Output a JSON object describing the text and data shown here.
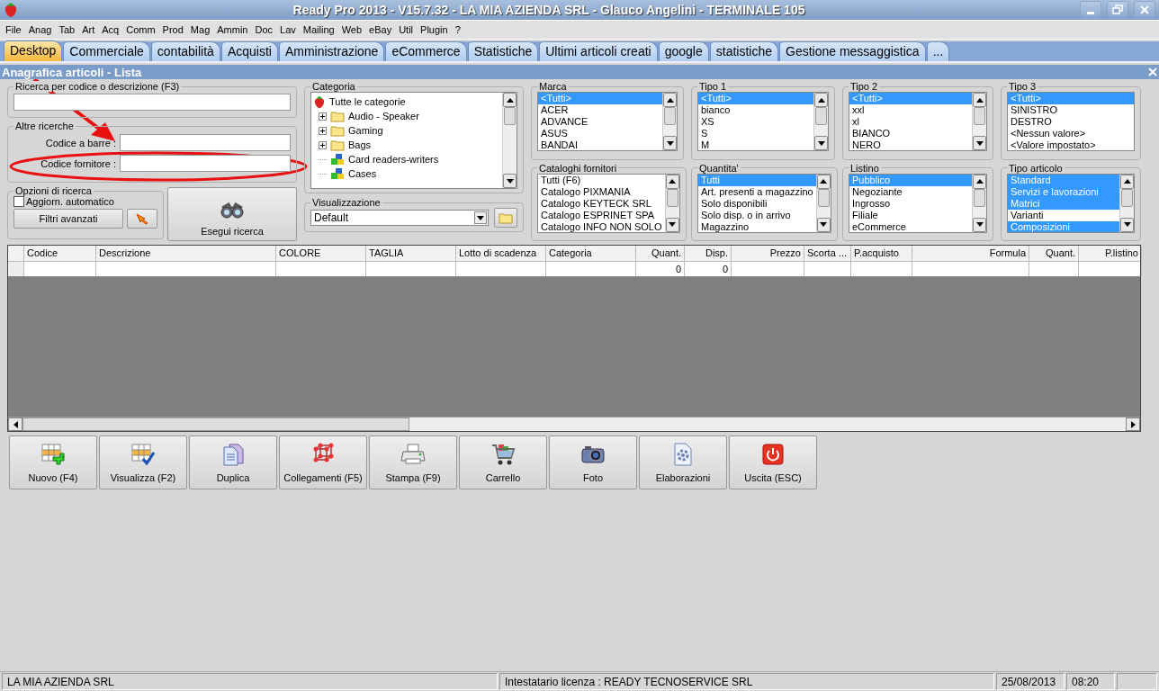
{
  "window": {
    "title": "Ready Pro 2013 - V15.7.32 - LA MIA AZIENDA SRL - Glauco Angelini - TERMINALE 105"
  },
  "menu": [
    "File",
    "Anag",
    "Tab",
    "Art",
    "Acq",
    "Comm",
    "Prod",
    "Mag",
    "Ammin",
    "Doc",
    "Lav",
    "Mailing",
    "Web",
    "eBay",
    "Util",
    "Plugin",
    "?"
  ],
  "tabs": [
    {
      "label": "Desktop",
      "selected": true
    },
    {
      "label": "Commerciale",
      "selected": false
    },
    {
      "label": "contabilità",
      "selected": false
    },
    {
      "label": "Acquisti",
      "selected": false
    },
    {
      "label": "Amministrazione",
      "selected": false
    },
    {
      "label": "eCommerce",
      "selected": false
    },
    {
      "label": "Statistiche",
      "selected": false
    },
    {
      "label": "Ultimi articoli creati",
      "selected": false
    },
    {
      "label": "google",
      "selected": false
    },
    {
      "label": "statistiche",
      "selected": false
    },
    {
      "label": "Gestione messaggistica",
      "selected": false
    },
    {
      "label": "...",
      "selected": false
    }
  ],
  "subwindow": {
    "title": "Anagrafica articoli  - Lista"
  },
  "search": {
    "title": "Ricerca per codice o descrizione (F3)"
  },
  "other_searches": {
    "title": "Altre ricerche",
    "fields": [
      {
        "label": "Codice a barre :"
      },
      {
        "label": "Codice fornitore :"
      }
    ]
  },
  "search_options": {
    "title": "Opzioni di ricerca",
    "checkbox": {
      "label": "Aggiorn. automatico",
      "checked": false
    },
    "filters_button": "Filtri avanzati"
  },
  "run_search_button": "Esegui ricerca",
  "category": {
    "title": "Categoria",
    "tree": [
      {
        "label": "Tutte le categorie",
        "kind": "root",
        "children": [
          {
            "label": "Audio - Speaker",
            "kind": "folder"
          },
          {
            "label": "Gaming",
            "kind": "folder"
          },
          {
            "label": "Bags",
            "kind": "folder"
          },
          {
            "label": "Card readers-writers",
            "kind": "item"
          },
          {
            "label": "Cases",
            "kind": "item"
          }
        ]
      }
    ]
  },
  "view": {
    "title": "Visualizzazione",
    "value": "Default"
  },
  "lists": [
    {
      "title": "Marca",
      "has_scrollbar": true,
      "items": [
        {
          "label": "<Tutti>",
          "selected": true
        },
        {
          "label": "ACER",
          "selected": false
        },
        {
          "label": "ADVANCE",
          "selected": false
        },
        {
          "label": "ASUS",
          "selected": false
        },
        {
          "label": "BANDAI",
          "selected": false
        }
      ]
    },
    {
      "title": "Tipo 1",
      "has_scrollbar": true,
      "items": [
        {
          "label": "<Tutti>",
          "selected": true
        },
        {
          "label": "bianco",
          "selected": false
        },
        {
          "label": "XS",
          "selected": false
        },
        {
          "label": "S",
          "selected": false
        },
        {
          "label": "M",
          "selected": false
        }
      ]
    },
    {
      "title": "Tipo 2",
      "has_scrollbar": true,
      "items": [
        {
          "label": "<Tutti>",
          "selected": true
        },
        {
          "label": "xxl",
          "selected": false
        },
        {
          "label": "xl",
          "selected": false
        },
        {
          "label": "BIANCO",
          "selected": false
        },
        {
          "label": "NERO",
          "selected": false
        }
      ]
    },
    {
      "title": "Tipo 3",
      "has_scrollbar": false,
      "items": [
        {
          "label": "<Tutti>",
          "selected": true
        },
        {
          "label": "SINISTRO",
          "selected": false
        },
        {
          "label": "DESTRO",
          "selected": false
        },
        {
          "label": "<Nessun valore>",
          "selected": false
        },
        {
          "label": "<Valore impostato>",
          "selected": false
        }
      ]
    },
    {
      "title": "Cataloghi fornitori",
      "has_scrollbar": true,
      "items": [
        {
          "label": "Tutti (F6)",
          "selected": false
        },
        {
          "label": "Catalogo PIXMANIA",
          "selected": false
        },
        {
          "label": "Catalogo KEYTECK SRL",
          "selected": false
        },
        {
          "label": "Catalogo ESPRINET SPA",
          "selected": false
        },
        {
          "label": "Catalogo INFO NON SOLO",
          "selected": false
        }
      ]
    },
    {
      "title": "Quantita'",
      "has_scrollbar": true,
      "items": [
        {
          "label": "Tutti",
          "selected": true
        },
        {
          "label": "Art. presenti a magazzino",
          "selected": false
        },
        {
          "label": "Solo disponibili",
          "selected": false
        },
        {
          "label": "Solo disp. o in arrivo",
          "selected": false
        },
        {
          "label": "Magazzino",
          "selected": false
        }
      ]
    },
    {
      "title": "Listino",
      "has_scrollbar": true,
      "items": [
        {
          "label": "Pubblico",
          "selected": true
        },
        {
          "label": "Negoziante",
          "selected": false
        },
        {
          "label": "Ingrosso",
          "selected": false
        },
        {
          "label": "Filiale",
          "selected": false
        },
        {
          "label": "eCommerce",
          "selected": false
        }
      ]
    },
    {
      "title": "Tipo articolo",
      "has_scrollbar": true,
      "items": [
        {
          "label": "Standard",
          "selected": true
        },
        {
          "label": "Servizi e lavorazioni",
          "selected": true
        },
        {
          "label": "Matrici",
          "selected": true
        },
        {
          "label": "Varianti",
          "selected": false
        },
        {
          "label": "Composizioni",
          "selected": true
        }
      ]
    }
  ],
  "table": {
    "columns": [
      "Codice",
      "Descrizione",
      "COLORE",
      "TAGLIA",
      "Lotto di scadenza",
      "Categoria",
      "Quant.",
      "Disp.",
      "Prezzo",
      "Scorta ...",
      "P.acquisto",
      "Formula",
      "Quant.",
      "P.listino"
    ],
    "rows": [
      {
        "quant": "0",
        "disp": "0"
      }
    ]
  },
  "toolbar": [
    {
      "label": "Nuovo (F4)",
      "kind": "new"
    },
    {
      "label": "Visualizza (F2)",
      "kind": "view"
    },
    {
      "label": "Duplica",
      "kind": "duplicate"
    },
    {
      "label": "Collegamenti (F5)",
      "kind": "links"
    },
    {
      "label": "Stampa (F9)",
      "kind": "print"
    },
    {
      "label": "Carrello",
      "kind": "cart"
    },
    {
      "label": "Foto",
      "kind": "photo"
    },
    {
      "label": "Elaborazioni",
      "kind": "process"
    },
    {
      "label": "Uscita (ESC)",
      "kind": "exit"
    }
  ],
  "status_bar": {
    "company": "LA MIA AZIENDA SRL",
    "license": "Intestatario licenza : READY TECNOSERVICE SRL",
    "date": "25/08/2013",
    "time": "08:20"
  }
}
